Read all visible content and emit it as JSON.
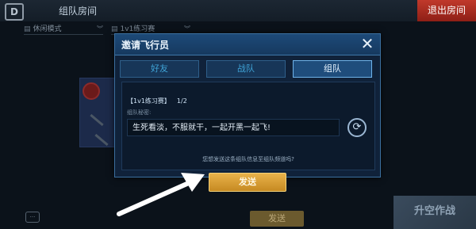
{
  "background": {
    "room_title": "组队房间",
    "exit_button": "退出房间",
    "mode_select": "休闲模式",
    "map_select": "1v1练习赛",
    "chat_send_button": "发送",
    "fight_button": "升空作战"
  },
  "dialog": {
    "title": "邀请飞行员",
    "close_icon": "close-x",
    "tabs": [
      {
        "label": "好友",
        "active": false
      },
      {
        "label": "战队",
        "active": false
      },
      {
        "label": "组队",
        "active": true
      }
    ],
    "mode_name": "【1v1练习赛】",
    "member_count": "1/2",
    "secret_label": "组队秘密:",
    "message": "生死看淡，不服就干，一起开黑一起飞!",
    "refresh_icon": "refresh-icon",
    "prompt": "您想发送这条组队信息至组队频道吗?",
    "send_button": "发送"
  },
  "colors": {
    "accent": "#3fa3d6",
    "send_button": "#e0a33a",
    "exit_button": "#c0392b"
  }
}
